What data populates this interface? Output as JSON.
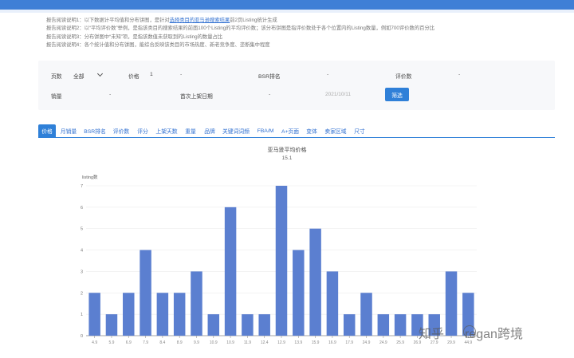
{
  "report_notes": [
    {
      "prefix": "报告阅读说明1：以下数据计平均值和分布饼图，是针对",
      "link": "选择类目的亚马逊搜索结果",
      "suffix": "前2页Listing统计生成"
    },
    {
      "prefix": "报告阅读说明2：以“平均评价数”举例，是指该类目的搜索结果的前面100个Listing的平均评价数；该分布饼图是指评价数处于各个位置内的Listing数量，例如700评价数的百分比",
      "link": "",
      "suffix": ""
    },
    {
      "prefix": "报告阅读说明3：分布饼图中“未知”项，是指该数值未获取到的Listing的数量占比",
      "link": "",
      "suffix": ""
    },
    {
      "prefix": "报告阅读说明4：各个统计值和分布饼图，能综合反映该类目的市场热度、新老竞争度、垄断集中程度",
      "link": "",
      "suffix": ""
    }
  ],
  "filters": {
    "pages_label": "页数",
    "pages_value": "全部",
    "price_label": "价格",
    "price_min": "1",
    "price_sep": "-",
    "bsr_label": "BSR排名",
    "bsr_sep": "-",
    "reviews_label": "评价数",
    "reviews_sep": "-",
    "sales_label": "销量",
    "sales_sep": "-",
    "launch_label": "首次上架日期",
    "launch_sep": "-",
    "launch_end": "2021/10/11",
    "submit_label": "筛选"
  },
  "tabs": [
    {
      "label": "价格",
      "active": true
    },
    {
      "label": "月销量",
      "active": false
    },
    {
      "label": "BSR排名",
      "active": false
    },
    {
      "label": "评价数",
      "active": false
    },
    {
      "label": "评分",
      "active": false
    },
    {
      "label": "上架天数",
      "active": false
    },
    {
      "label": "重量",
      "active": false
    },
    {
      "label": "品牌",
      "active": false
    },
    {
      "label": "关键词词频",
      "active": false
    },
    {
      "label": "FBA/M",
      "active": false
    },
    {
      "label": "A+页面",
      "active": false
    },
    {
      "label": "变体",
      "active": false
    },
    {
      "label": "卖家区域",
      "active": false
    },
    {
      "label": "尺寸",
      "active": false
    }
  ],
  "chart_data": {
    "type": "bar",
    "title": "亚马逊平均价格",
    "subtitle": "15.1",
    "ylabel": "listing数",
    "xlabel": "",
    "categories": [
      "4.9",
      "5.9",
      "6.9",
      "7.9",
      "8.4",
      "8.9",
      "9.9",
      "10.9",
      "10.9",
      "11.9",
      "12.4",
      "12.9",
      "13.9",
      "15.9",
      "16.9",
      "17.9",
      "24.9",
      "24.9",
      "25.9",
      "26.9",
      "27.9",
      "29.9",
      "44.9"
    ],
    "values": [
      2,
      1,
      2,
      4,
      2,
      2,
      3,
      1,
      6,
      1,
      1,
      7,
      4,
      5,
      3,
      1,
      2,
      1,
      1,
      1,
      1,
      3,
      2
    ],
    "ylim": [
      0,
      7
    ],
    "yticks": [
      0,
      1,
      2,
      3,
      4,
      5,
      6,
      7
    ],
    "grid": true,
    "bar_color": "#5b7fd0"
  },
  "watermark": {
    "site": "知乎",
    "account": "regan跨境"
  }
}
